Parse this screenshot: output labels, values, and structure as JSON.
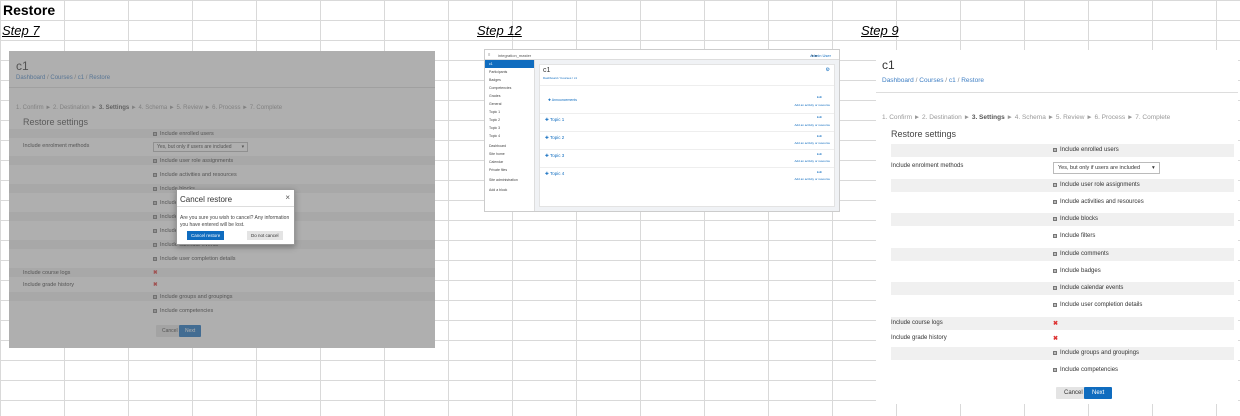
{
  "sheet": {
    "title": "Restore",
    "steps": [
      "Step 7",
      "Step 12",
      "Step 9"
    ]
  },
  "restore_page": {
    "course": "c1",
    "breadcrumb": [
      "Dashboard",
      "Courses",
      "c1",
      "Restore"
    ],
    "progress": {
      "before": "1. Confirm ► 2. Destination ► ",
      "current": "3. Settings",
      "after": " ► 4. Schema ► 5. Review ► 6. Process ► 7. Complete"
    },
    "section_title": "Restore settings",
    "enrolment_label": "Include enrolment methods",
    "enrolment_value": "Yes, but only if users are included",
    "settings": [
      {
        "label": "",
        "text": "Include enrolled users",
        "type": "checkbox"
      },
      {
        "label": "Include enrolment methods",
        "text": "Yes, but only if users are included",
        "type": "select"
      },
      {
        "label": "",
        "text": "Include user role assignments",
        "type": "checkbox"
      },
      {
        "label": "",
        "text": "Include activities and resources",
        "type": "checkbox"
      },
      {
        "label": "",
        "text": "Include blocks",
        "type": "checkbox"
      },
      {
        "label": "",
        "text": "Include filters",
        "type": "checkbox"
      },
      {
        "label": "",
        "text": "Include comments",
        "type": "checkbox"
      },
      {
        "label": "",
        "text": "Include badges",
        "type": "checkbox"
      },
      {
        "label": "",
        "text": "Include calendar events",
        "type": "checkbox"
      },
      {
        "label": "",
        "text": "Include user completion details",
        "type": "checkbox"
      },
      {
        "label": "Include course logs",
        "text": "",
        "type": "cross"
      },
      {
        "label": "Include grade history",
        "text": "",
        "type": "cross"
      },
      {
        "label": "",
        "text": "Include groups and groupings",
        "type": "checkbox"
      },
      {
        "label": "",
        "text": "Include competencies",
        "type": "checkbox"
      }
    ],
    "cancel_label": "Cancel",
    "next_label": "Next"
  },
  "cancel_modal": {
    "title": "Cancel restore",
    "close": "×",
    "body": "Are you sure you wish to cancel? Any information you have entered will be lost.",
    "confirm_label": "Cancel restore",
    "dismiss_label": "Do not cancel"
  },
  "step12": {
    "site_name": "integration_master",
    "user_label": "Admin User",
    "course": "c1",
    "breadcrumb": "Dashboard / Courses / c1",
    "nav": [
      "c1",
      "Participants",
      "Badges",
      "Competencies",
      "Grades",
      "General",
      "Topic 1",
      "Topic 2",
      "Topic 3",
      "Topic 4",
      "Dashboard",
      "Site home",
      "Calendar",
      "Private files",
      "Site administration",
      "Add a block"
    ],
    "announcements": "Announcements",
    "topics": [
      "Topic 1",
      "Topic 2",
      "Topic 3",
      "Topic 4"
    ],
    "edit_label": "Edit",
    "add_label": "Add an activity or resource"
  }
}
